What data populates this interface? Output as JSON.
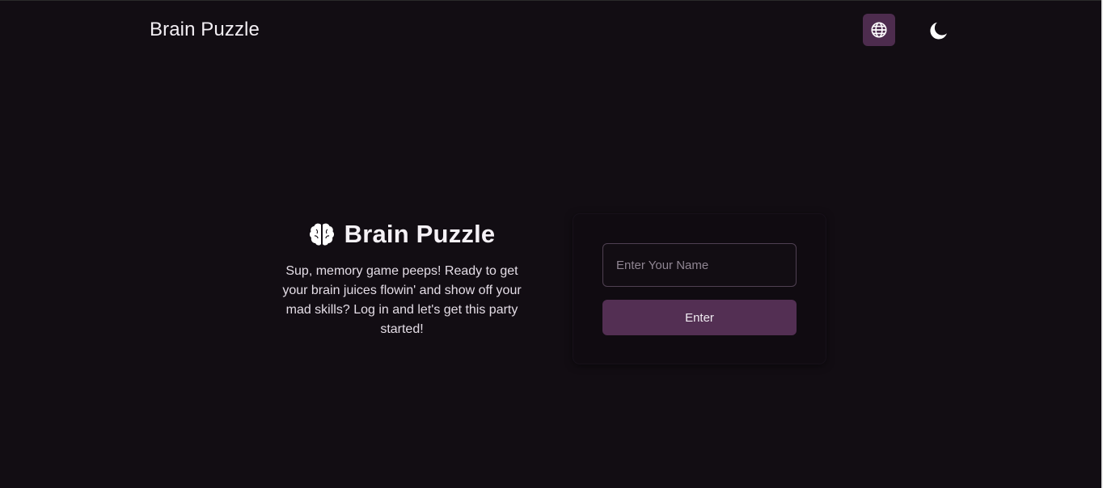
{
  "header": {
    "brand": "Brain Puzzle",
    "language_icon": "globe-icon",
    "theme_icon": "moon-icon"
  },
  "intro": {
    "logo_icon": "brain-icon",
    "title": "Brain Puzzle",
    "description": "Sup, memory game peeps! Ready to get your brain juices flowin' and show off your mad skills? Log in and let's get this party started!"
  },
  "login": {
    "name_placeholder": "Enter Your Name",
    "name_value": "",
    "submit_label": "Enter"
  },
  "colors": {
    "background": "#120d13",
    "accent": "#532f53",
    "text": "#f3eff4"
  }
}
